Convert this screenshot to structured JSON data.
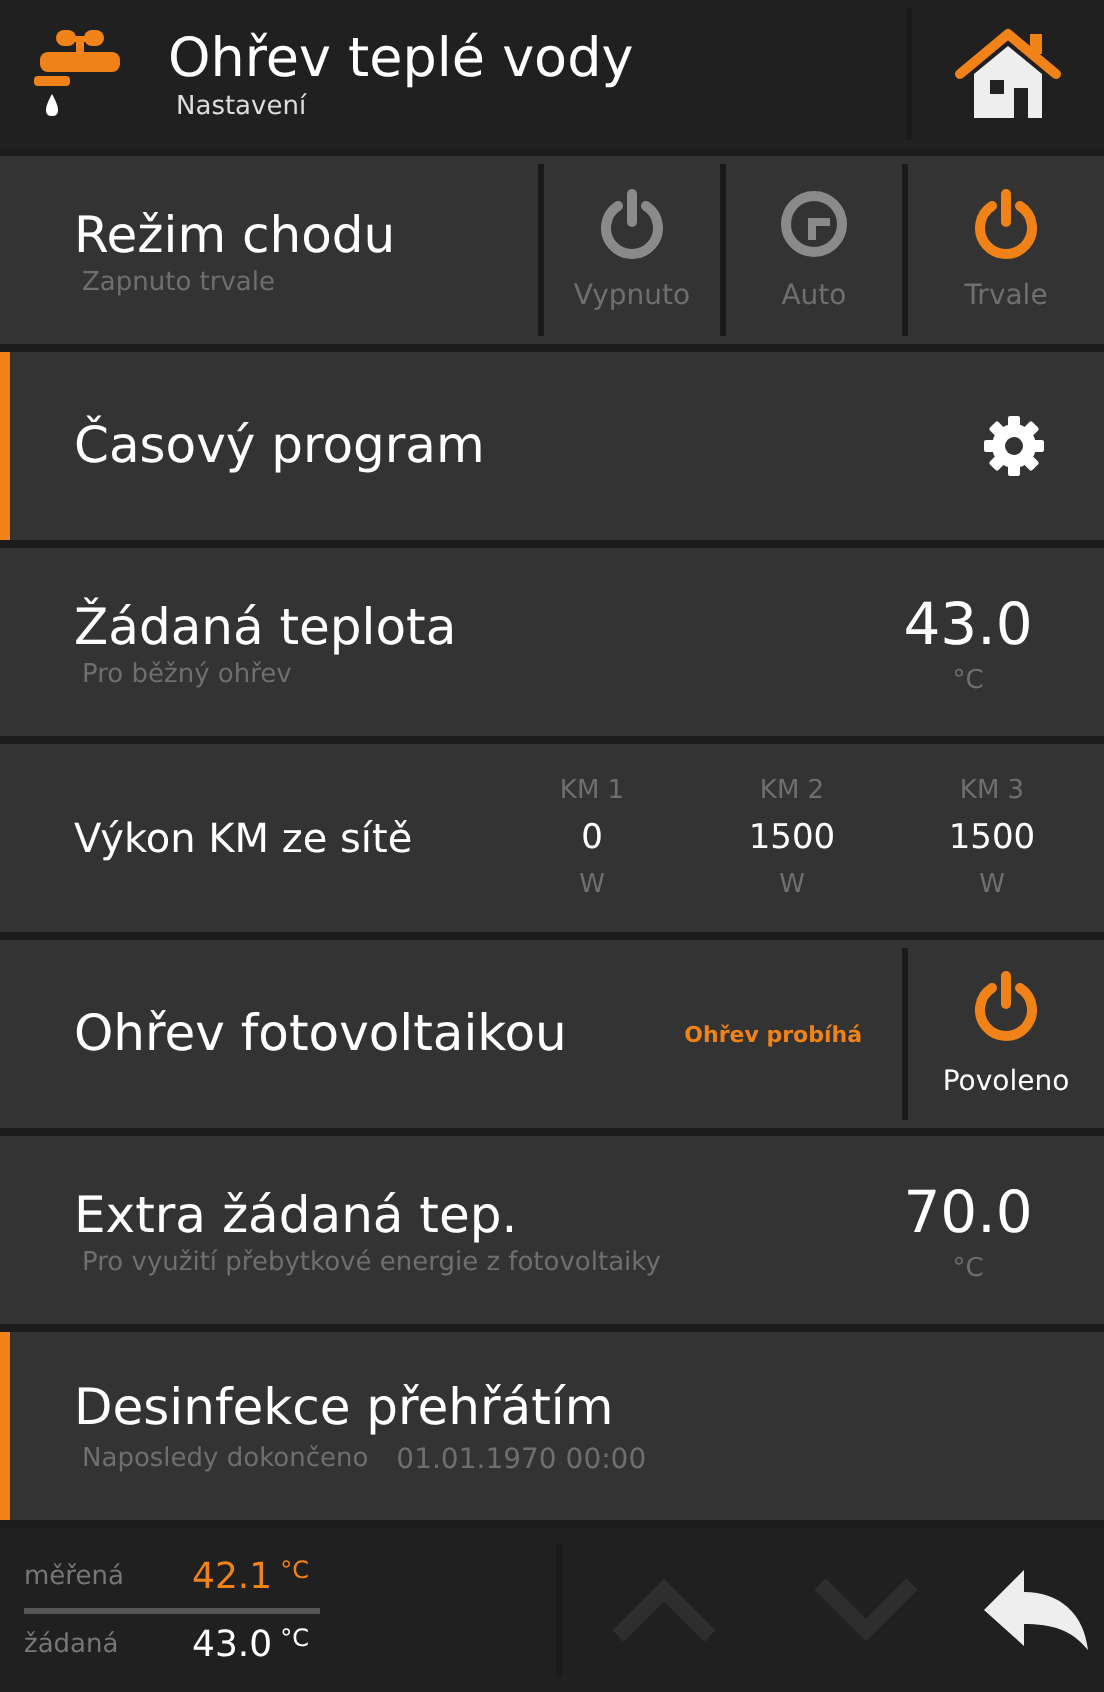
{
  "header": {
    "title": "Ohřev teplé vody",
    "subtitle": "Nastavení"
  },
  "rows": [
    {
      "kind": "mode",
      "title": "Režim chodu",
      "subtitle": "Zapnuto trvale",
      "accent": false,
      "options": [
        {
          "kind": "power",
          "label": "Vypnuto",
          "selected": false
        },
        {
          "kind": "auto",
          "label": "Auto",
          "selected": false
        },
        {
          "kind": "power",
          "label": "Trvale",
          "selected": true
        }
      ]
    },
    {
      "kind": "link",
      "title": "Časový program",
      "accent": true
    },
    {
      "kind": "value",
      "title": "Žádaná teplota",
      "subtitle": "Pro běžný ohřev",
      "accent": false,
      "value": "43.0",
      "unit": "°C"
    },
    {
      "kind": "powers",
      "title": "Výkon KM ze sítě",
      "accent": false,
      "columns": [
        {
          "label": "KM 1",
          "value": "0",
          "unit": "W"
        },
        {
          "label": "KM 2",
          "value": "1500",
          "unit": "W"
        },
        {
          "label": "KM 3",
          "value": "1500",
          "unit": "W"
        }
      ]
    },
    {
      "kind": "toggle",
      "title": "Ohřev fotovoltaikou",
      "status": "Ohřev probíhá",
      "accent": false,
      "button": {
        "label": "Povoleno",
        "on": true
      }
    },
    {
      "kind": "value",
      "title": "Extra žádaná tep.",
      "subtitle": "Pro využití přebytkové energie z fotovoltaiky",
      "accent": false,
      "value": "70.0",
      "unit": "°C"
    },
    {
      "kind": "info",
      "title": "Desinfekce přehřátím",
      "subtitle": "Naposledy dokončeno",
      "date": "01.01.1970 00:00",
      "accent": true
    }
  ],
  "footer": {
    "readings": [
      {
        "label": "měřená",
        "value": "42.1",
        "unit": "°C",
        "kind": "measured"
      },
      {
        "label": "žádaná",
        "value": "43.0",
        "unit": "°C",
        "kind": "set"
      }
    ],
    "up": {
      "disabled": true
    },
    "down": {
      "disabled": true
    }
  }
}
